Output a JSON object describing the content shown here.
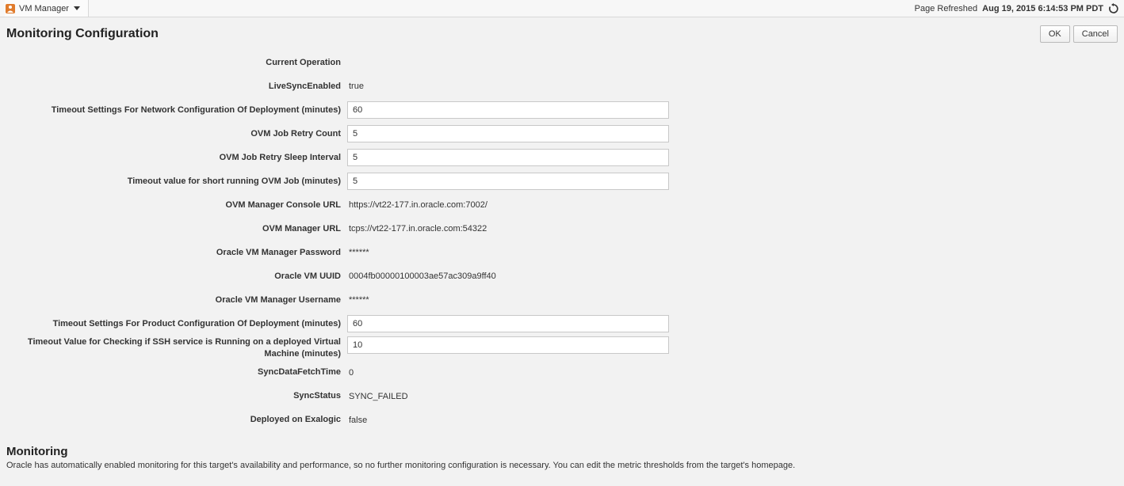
{
  "topbar": {
    "menu_label": "VM Manager",
    "page_refreshed_label": "Page Refreshed",
    "page_refreshed_ts": "Aug 19, 2015 6:14:53 PM PDT"
  },
  "header": {
    "title": "Monitoring Configuration",
    "ok_label": "OK",
    "cancel_label": "Cancel"
  },
  "fields": {
    "current_operation": {
      "label": "Current Operation",
      "value": "",
      "type": "readonly"
    },
    "live_sync_enabled": {
      "label": "LiveSyncEnabled",
      "value": "true",
      "type": "readonly"
    },
    "timeout_network_cfg": {
      "label": "Timeout Settings For Network Configuration Of Deployment (minutes)",
      "value": "60",
      "type": "text"
    },
    "ovm_job_retry_count": {
      "label": "OVM Job Retry Count",
      "value": "5",
      "type": "text"
    },
    "ovm_job_retry_sleep": {
      "label": "OVM Job Retry Sleep Interval",
      "value": "5",
      "type": "text"
    },
    "timeout_short_ovm": {
      "label": "Timeout value for short running OVM Job (minutes)",
      "value": "5",
      "type": "text"
    },
    "ovm_console_url": {
      "label": "OVM Manager Console URL",
      "value": "https://vt22-177.in.oracle.com:7002/",
      "type": "readonly"
    },
    "ovm_manager_url": {
      "label": "OVM Manager URL",
      "value": "tcps://vt22-177.in.oracle.com:54322",
      "type": "readonly"
    },
    "ovm_password": {
      "label": "Oracle VM Manager Password",
      "value": "******",
      "type": "readonly"
    },
    "ovm_uuid": {
      "label": "Oracle VM UUID",
      "value": "0004fb00000100003ae57ac309a9ff40",
      "type": "readonly"
    },
    "ovm_username": {
      "label": "Oracle VM Manager Username",
      "value": "******",
      "type": "readonly"
    },
    "timeout_product_cfg": {
      "label": "Timeout Settings For Product Configuration Of Deployment (minutes)",
      "value": "60",
      "type": "text"
    },
    "timeout_ssh_check": {
      "label": "Timeout Value for Checking if SSH service is Running on a deployed Virtual Machine (minutes)",
      "value": "10",
      "type": "text"
    },
    "sync_data_fetch_time": {
      "label": "SyncDataFetchTime",
      "value": "0",
      "type": "readonly"
    },
    "sync_status": {
      "label": "SyncStatus",
      "value": "SYNC_FAILED",
      "type": "readonly"
    },
    "deployed_on_exalogic": {
      "label": "Deployed on Exalogic",
      "value": "false",
      "type": "readonly"
    }
  },
  "monitoring_section": {
    "title": "Monitoring",
    "desc": "Oracle has automatically enabled monitoring for this target's availability and performance, so no further monitoring configuration is necessary. You can edit the metric thresholds from the target's homepage."
  }
}
